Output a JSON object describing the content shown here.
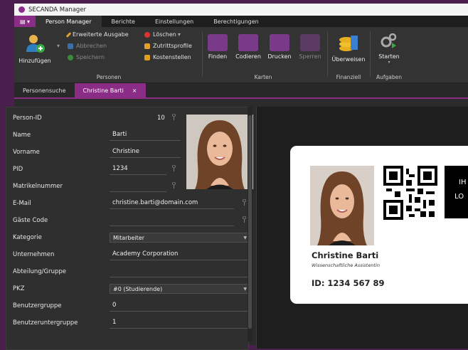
{
  "window": {
    "title": "SECANDA Manager"
  },
  "menu": {
    "tabs": [
      "Person Manager",
      "Berichte",
      "Einstellungen",
      "Berechtigungen"
    ]
  },
  "ribbon": {
    "add_label": "Hinzufügen",
    "extended_output": "Erweiterte Ausgabe",
    "cancel": "Abbrechen",
    "save": "Speichern",
    "delete": "Löschen",
    "access_profiles": "Zutrittsprofile",
    "cost_centers": "Kostenstellen",
    "group_persons": "Personen",
    "find": "Finden",
    "encode": "Codieren",
    "print": "Drucken",
    "lock": "Sperren",
    "group_cards": "Karten",
    "transfer": "Überweisen",
    "group_finance": "Finanziell",
    "start": "Starten",
    "group_tasks": "Aufgaben"
  },
  "doc_tabs": {
    "search": "Personensuche",
    "person": "Christine Barti",
    "close": "×"
  },
  "form": {
    "person_id_label": "Person-ID",
    "person_id": "10",
    "name_label": "Name",
    "name": "Barti",
    "firstname_label": "Vorname",
    "firstname": "Christine",
    "pid_label": "PID",
    "pid": "1234",
    "matrikel_label": "Matrikelnummer",
    "email_label": "E-Mail",
    "email": "christine.barti@domain.com",
    "guest_label": "Gäste Code",
    "category_label": "Kategorie",
    "category": "Mitarbeiter",
    "company_label": "Unternehmen",
    "company": "Academy Corporation",
    "department_label": "Abteilung/Gruppe",
    "pkz_label": "PKZ",
    "pkz": "#0 (Studierende)",
    "usergroup_label": "Benutzergruppe",
    "usergroup": "0",
    "subgroup_label": "Benutzeruntergruppe",
    "subgroup": "1"
  },
  "card": {
    "name": "Christine Barti",
    "role": "Wissenschaftliche Assistentin",
    "id_line": "ID: 1234 567 89",
    "side_text_1": "IH",
    "side_text_2": "LO"
  },
  "colors": {
    "accent": "#8b2c86",
    "ribbon_bg": "#333333"
  }
}
